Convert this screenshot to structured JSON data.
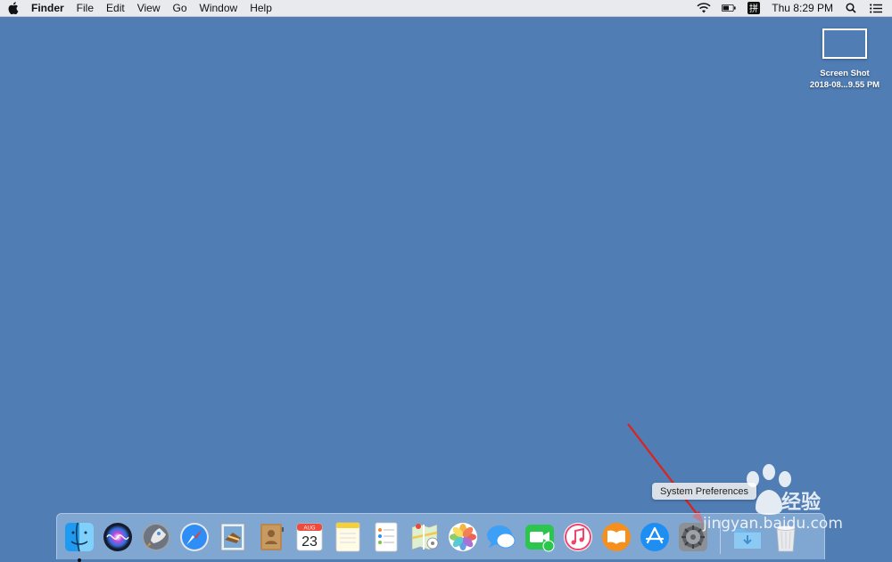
{
  "menubar": {
    "app_name": "Finder",
    "items": [
      "File",
      "Edit",
      "View",
      "Go",
      "Window",
      "Help"
    ],
    "clock": "Thu 8:29 PM",
    "input_source": "拼"
  },
  "desktop": {
    "file_name_line1": "Screen Shot",
    "file_name_line2": "2018-08...9.55 PM",
    "background_color": "#4f7db4"
  },
  "tooltip": {
    "label": "System Preferences"
  },
  "dock": {
    "apps": [
      {
        "name": "Finder",
        "icon": "finder-icon"
      },
      {
        "name": "Siri",
        "icon": "siri-icon"
      },
      {
        "name": "Launchpad",
        "icon": "launchpad-icon"
      },
      {
        "name": "Safari",
        "icon": "safari-icon"
      },
      {
        "name": "Mail",
        "icon": "mail-icon"
      },
      {
        "name": "Contacts",
        "icon": "contacts-icon"
      },
      {
        "name": "Calendar",
        "icon": "calendar-icon",
        "month": "AUG",
        "day": "23"
      },
      {
        "name": "Notes",
        "icon": "notes-icon"
      },
      {
        "name": "Reminders",
        "icon": "reminders-icon"
      },
      {
        "name": "Maps",
        "icon": "maps-icon"
      },
      {
        "name": "Photos",
        "icon": "photos-icon"
      },
      {
        "name": "Messages",
        "icon": "messages-icon"
      },
      {
        "name": "FaceTime",
        "icon": "facetime-icon"
      },
      {
        "name": "iTunes",
        "icon": "itunes-icon"
      },
      {
        "name": "iBooks",
        "icon": "ibooks-icon"
      },
      {
        "name": "App Store",
        "icon": "app-store-icon"
      },
      {
        "name": "System Preferences",
        "icon": "system-preferences-icon"
      },
      {
        "name": "Downloads",
        "icon": "downloads-folder-icon"
      },
      {
        "name": "Trash",
        "icon": "trash-icon"
      }
    ]
  },
  "watermark": {
    "text": "jingyan.baidu.com",
    "cn": "经验"
  },
  "colors": {
    "arrow": "#e0201b",
    "desktop": "#4f7db4"
  }
}
